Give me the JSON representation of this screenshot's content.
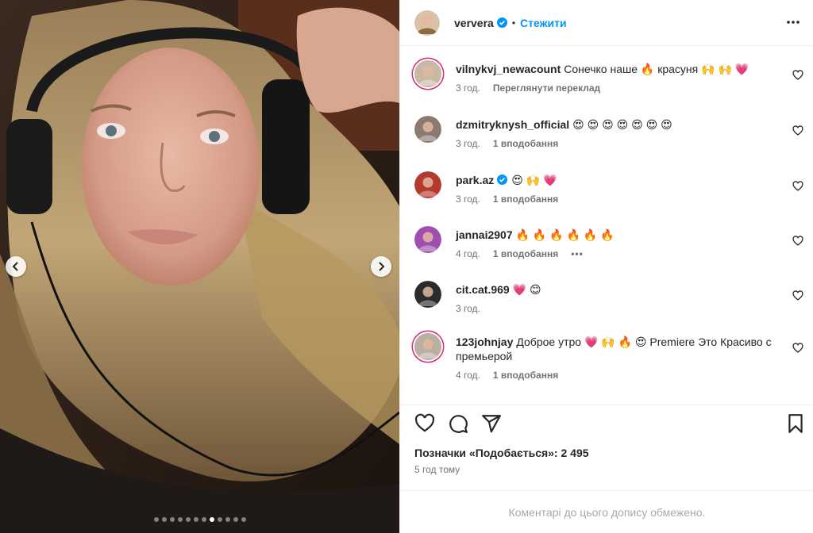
{
  "post": {
    "username": "ververa",
    "verified": true,
    "separator": "•",
    "follow_label": "Стежити",
    "more_icon": "more-horizontal-icon"
  },
  "media": {
    "description_colors": {
      "hair": "#b3966a",
      "background": "#2a1d16",
      "skin": "#d9a793"
    },
    "carousel": {
      "total": 12,
      "active_index": 7
    }
  },
  "comments": [
    {
      "user": "vilnykvj_newacount",
      "text": "Сонечко наше 🔥 красуня 🙌 🙌 💗",
      "time": "3 год.",
      "extra": "Переглянути переклад",
      "likes": "",
      "story_ring": true,
      "verified": false,
      "avatar_color": "#c9b9a4"
    },
    {
      "user": "dzmitryknysh_official",
      "text": "😍 😍 😍 😍 😍 😍 😍",
      "time": "3 год.",
      "extra": "",
      "likes": "1 вподобання",
      "story_ring": false,
      "verified": false,
      "avatar_color": "#8a7a70"
    },
    {
      "user": "park.az",
      "text": "😍 🙌 💗",
      "time": "3 год.",
      "extra": "",
      "likes": "1 вподобання",
      "story_ring": false,
      "verified": true,
      "avatar_color": "#b43a2e"
    },
    {
      "user": "jannai2907",
      "text": "🔥 🔥 🔥 🔥 🔥 🔥",
      "time": "4 год.",
      "extra": "",
      "likes": "1 вподобання",
      "story_ring": false,
      "verified": false,
      "avatar_color": "#a04fb0",
      "show_more": "•••"
    },
    {
      "user": "cit.cat.969",
      "text": "💗 😊",
      "time": "3 год.",
      "extra": "",
      "likes": "",
      "story_ring": false,
      "verified": false,
      "avatar_color": "#2b2b2b"
    },
    {
      "user": "123johnjay",
      "text": "Доброе утро 💗 🙌 🔥 😍 Premiere Это Красиво с премьерой",
      "time": "4 год.",
      "extra": "",
      "likes": "1 вподобання",
      "story_ring": true,
      "verified": false,
      "avatar_color": "#b9b0a2"
    }
  ],
  "actions": {
    "icons": [
      "heart-icon",
      "comment-icon",
      "share-icon",
      "bookmark-icon"
    ]
  },
  "likes_text": "Позначки «Подобається»: 2 495",
  "posted_time": "5 год тому",
  "comments_limited": "Коментарі до цього допису обмежено.",
  "colors": {
    "accent": "#0095f6",
    "verified": "#0095f6",
    "text": "#262626",
    "muted": "#737373",
    "border": "#efefef"
  }
}
